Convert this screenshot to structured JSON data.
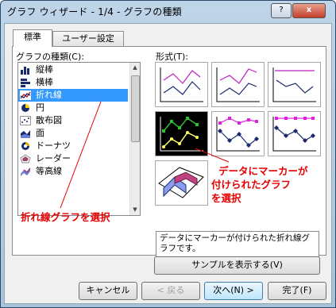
{
  "window": {
    "title": "グラフ ウィザード - 1/4 - グラフの種類",
    "help": "?",
    "close": "x"
  },
  "tabs": [
    {
      "label": "標準"
    },
    {
      "label": "ユーザー設定"
    }
  ],
  "chart_types": {
    "label": "グラフの種類(C):",
    "items": [
      "縦棒",
      "横棒",
      "折れ線",
      "円",
      "散布図",
      "面",
      "ドーナツ",
      "レーダー",
      "等高線"
    ],
    "selected": "折れ線"
  },
  "subtypes": {
    "label": "形式(T):"
  },
  "description": "データにマーカーが付けられた折れ線グラフです。",
  "buttons": {
    "sample": "サンプルを表示する(V)",
    "cancel": "キャンセル",
    "back": "< 戻る",
    "next": "次へ(N) >",
    "finish": "完了(F)"
  },
  "annotations": {
    "left": "折れ線グラフを選択",
    "right_line1": "データにマーカーが",
    "right_line2": "付けられたグラフ",
    "right_line3": "を選択"
  },
  "colors": {
    "selection": "#3399ff",
    "annotation": "#e60000"
  }
}
